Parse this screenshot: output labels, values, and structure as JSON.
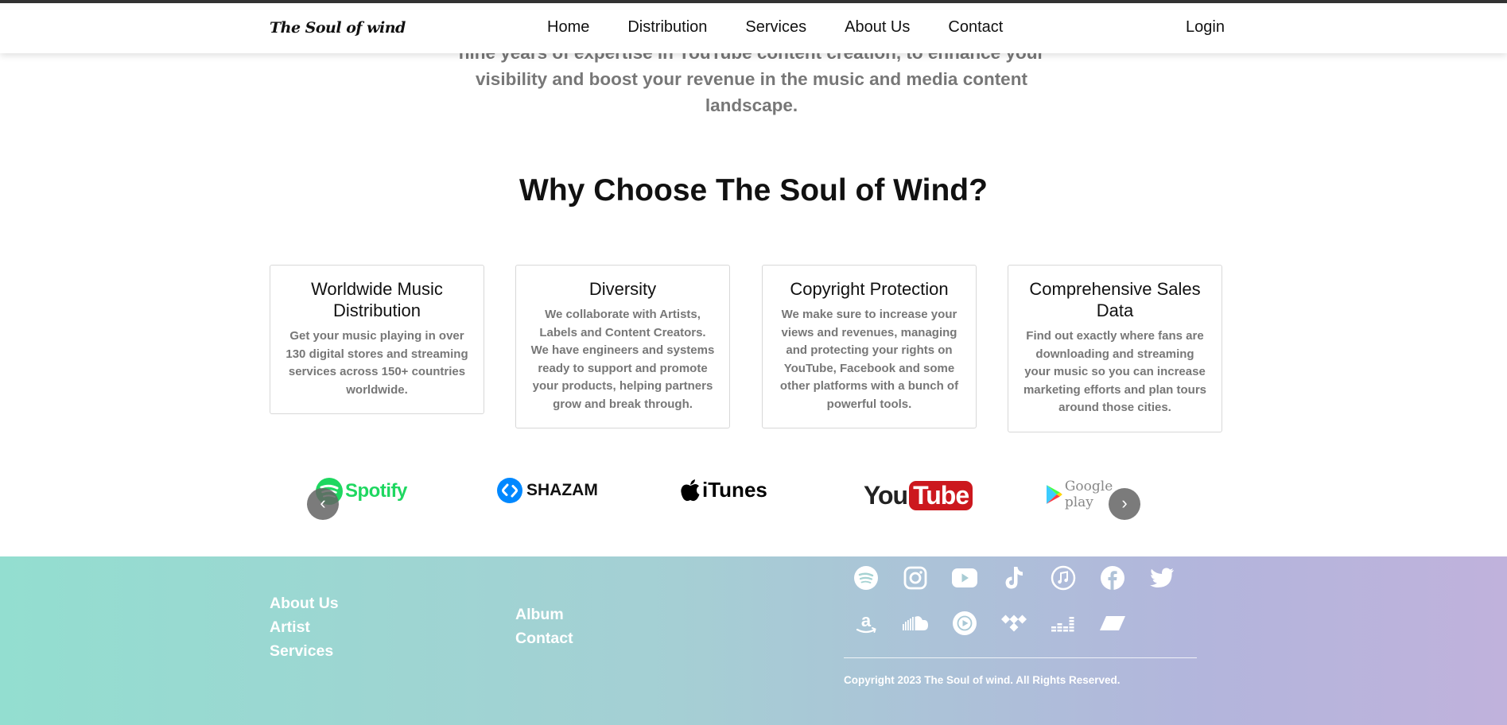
{
  "nav": {
    "brand": "The Soul of wind",
    "links": [
      "Home",
      "Distribution",
      "Services",
      "About Us",
      "Contact"
    ],
    "login": "Login"
  },
  "intro": {
    "line1": "nine years of expertise in YouTube content creation, to enhance your",
    "line2": "visibility and boost your revenue in the music and media content",
    "line3": "landscape."
  },
  "section_title": "Why Choose The Soul of Wind?",
  "cards": [
    {
      "title": "Worldwide Music Distribution",
      "text": "Get your music playing in over 130 digital stores and streaming services across 150+ countries worldwide."
    },
    {
      "title": "Diversity",
      "text": "We collaborate with Artists, Labels and Content Creators. We have engineers and systems ready to support and promote your products, helping partners grow and break through."
    },
    {
      "title": "Copyright Protection",
      "text": "We make sure to increase your views and revenues, managing and protecting your rights on YouTube, Facebook and some other platforms with a bunch of powerful tools."
    },
    {
      "title": "Comprehensive Sales Data",
      "text": "Find out exactly where fans are downloading and streaming your music so you can increase marketing efforts and plan tours around those cities."
    }
  ],
  "logos": {
    "spotify": "Spotify",
    "shazam": "SHAZAM",
    "itunes": "iTunes",
    "youtube_you": "You",
    "youtube_tube": "Tube",
    "google_play": "Google play"
  },
  "carousel": {
    "prev": "‹",
    "next": "›"
  },
  "footer": {
    "col1": [
      "About Us",
      "Artist",
      "Services"
    ],
    "col2": [
      "Album",
      "Contact"
    ],
    "social_row1": [
      "spotify-icon",
      "instagram-icon",
      "youtube-icon",
      "tiktok-icon",
      "apple-music-icon",
      "facebook-icon",
      "twitter-icon"
    ],
    "social_row2": [
      "amazon-icon",
      "soundcloud-icon",
      "youtube-music-icon",
      "tidal-icon",
      "deezer-icon",
      "napster-icon"
    ],
    "copyright": "Copyright 2023 The Soul of wind. All Rights Reserved."
  },
  "colors": {
    "spotify_green": "#1ed760",
    "shazam_blue": "#0088ff",
    "youtube_red": "#cc181e",
    "footer_start": "#93ded0",
    "footer_end": "#c0b2dc"
  }
}
